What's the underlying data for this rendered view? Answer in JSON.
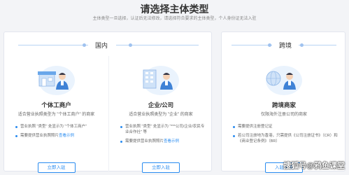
{
  "header": {
    "title": "请选择主体类型",
    "subtitle": "主体类型一旦选择，认证后无法修改，请选择符合要求的主体类型，个人身份证无法入驻"
  },
  "sections": {
    "domestic": {
      "label": "国内"
    },
    "overseas": {
      "label": "跨境"
    }
  },
  "cards": [
    {
      "title": "个体工商户",
      "desc": "适合营业执照类型为 \"个体工商户\" 的商家",
      "bullets": [
        "营业执照 \"类型\" 处显示为 \"个体工商户\"",
        "需要提供营业执照照片"
      ],
      "example_link": "查看示例",
      "button": "立即入驻"
    },
    {
      "title": "企业/公司",
      "desc": "适合营业执照类型为 \"企业\" 的商家",
      "bullets": [
        "营业执照 \"类型\" 处显示为 \"***公司/企业/农民专业合作社\" 等",
        "需要提供营业执照照片"
      ],
      "example_link": "查看示例",
      "button": "立即入驻"
    },
    {
      "title": "跨境商家",
      "desc": "仅限海外注册公司的商家",
      "bullets": [
        "需要提供注册登记证",
        "若公司注册地为香港，只需提供《公司注册证书》（CR）和《商业登记条例》（BR）"
      ],
      "button": "入驻申请"
    }
  ],
  "watermark": "搜狐号@鸦鱼课堂",
  "colors": {
    "accent": "#2a8cf0",
    "background": "#f3f4f7"
  }
}
